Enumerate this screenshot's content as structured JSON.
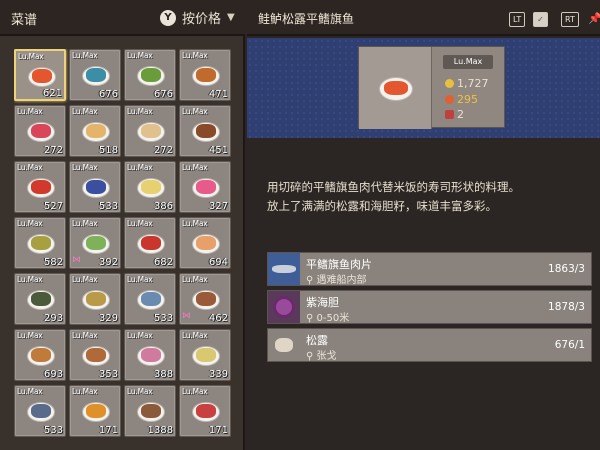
{
  "left_panel": {
    "title": "菜谱",
    "sort_button_glyph": "Y",
    "sort_label": "按价格"
  },
  "recipes": [
    {
      "level": "Lu.Max",
      "count": "621",
      "selected": true,
      "color": "#e4572e"
    },
    {
      "level": "Lu.Max",
      "count": "676",
      "color": "#3b8ea5"
    },
    {
      "level": "Lu.Max",
      "count": "676",
      "color": "#6a9c3b"
    },
    {
      "level": "Lu.Max",
      "count": "471",
      "color": "#c06a2b"
    },
    {
      "level": "Lu.Max",
      "count": "272",
      "color": "#d9465a"
    },
    {
      "level": "Lu.Max",
      "count": "518",
      "color": "#e3b56b"
    },
    {
      "level": "Lu.Max",
      "count": "272",
      "color": "#e0c08c"
    },
    {
      "level": "Lu.Max",
      "count": "451",
      "color": "#8a4a2a"
    },
    {
      "level": "Lu.Max",
      "count": "527",
      "color": "#d0392b"
    },
    {
      "level": "Lu.Max",
      "count": "533",
      "color": "#3a4fa0"
    },
    {
      "level": "Lu.Max",
      "count": "386",
      "color": "#e6d070"
    },
    {
      "level": "Lu.Max",
      "count": "327",
      "color": "#e85a8a"
    },
    {
      "level": "Lu.Max",
      "count": "582",
      "color": "#a8a040"
    },
    {
      "level": "Lu.Max",
      "count": "392",
      "bow": true,
      "color": "#7fb05a"
    },
    {
      "level": "Lu.Max",
      "count": "682",
      "color": "#c8362e"
    },
    {
      "level": "Lu.Max",
      "count": "694",
      "color": "#e8a06a"
    },
    {
      "level": "Lu.Max",
      "count": "293",
      "color": "#4a5a3a"
    },
    {
      "level": "Lu.Max",
      "count": "329",
      "color": "#b89a48"
    },
    {
      "level": "Lu.Max",
      "count": "533",
      "color": "#6a8ab0"
    },
    {
      "level": "Lu.Max",
      "count": "462",
      "bow": true,
      "color": "#9a5a3a"
    },
    {
      "level": "Lu.Max",
      "count": "693",
      "color": "#c07a3a"
    },
    {
      "level": "Lu.Max",
      "count": "353",
      "color": "#b06a3a"
    },
    {
      "level": "Lu.Max",
      "count": "388",
      "color": "#d07aa0"
    },
    {
      "level": "Lu.Max",
      "count": "339",
      "color": "#d8c870"
    },
    {
      "level": "Lu.Max",
      "count": "533",
      "color": "#5a6a8a"
    },
    {
      "level": "Lu.Max",
      "count": "171",
      "color": "#e0902a"
    },
    {
      "level": "Lu.Max",
      "count": "1388",
      "color": "#8a5a3a"
    },
    {
      "level": "Lu.Max",
      "count": "171",
      "color": "#c84040"
    }
  ],
  "detail": {
    "title": "鲑鲈松露平鳍旗鱼",
    "lt_label": "LT",
    "rt_label": "RT",
    "level": "Lu.Max",
    "price": "1,727",
    "value2": "295",
    "value3": "2",
    "description_line1": "用切碎的平鳍旗鱼肉代替米饭的寿司形状的料理。",
    "description_line2": "放上了满满的松露和海胆籽，味道丰富多彩。",
    "ingredients": [
      {
        "name": "平鳍旗鱼肉片",
        "location": "遇难船内部",
        "count": "1863/3",
        "icon": "swordfish-icon"
      },
      {
        "name": "紫海胆",
        "location": "0-50米",
        "count": "1878/3",
        "icon": "sea-urchin-icon"
      },
      {
        "name": "松露",
        "location": "张戈",
        "count": "676/1",
        "icon": "truffle-icon"
      }
    ]
  }
}
